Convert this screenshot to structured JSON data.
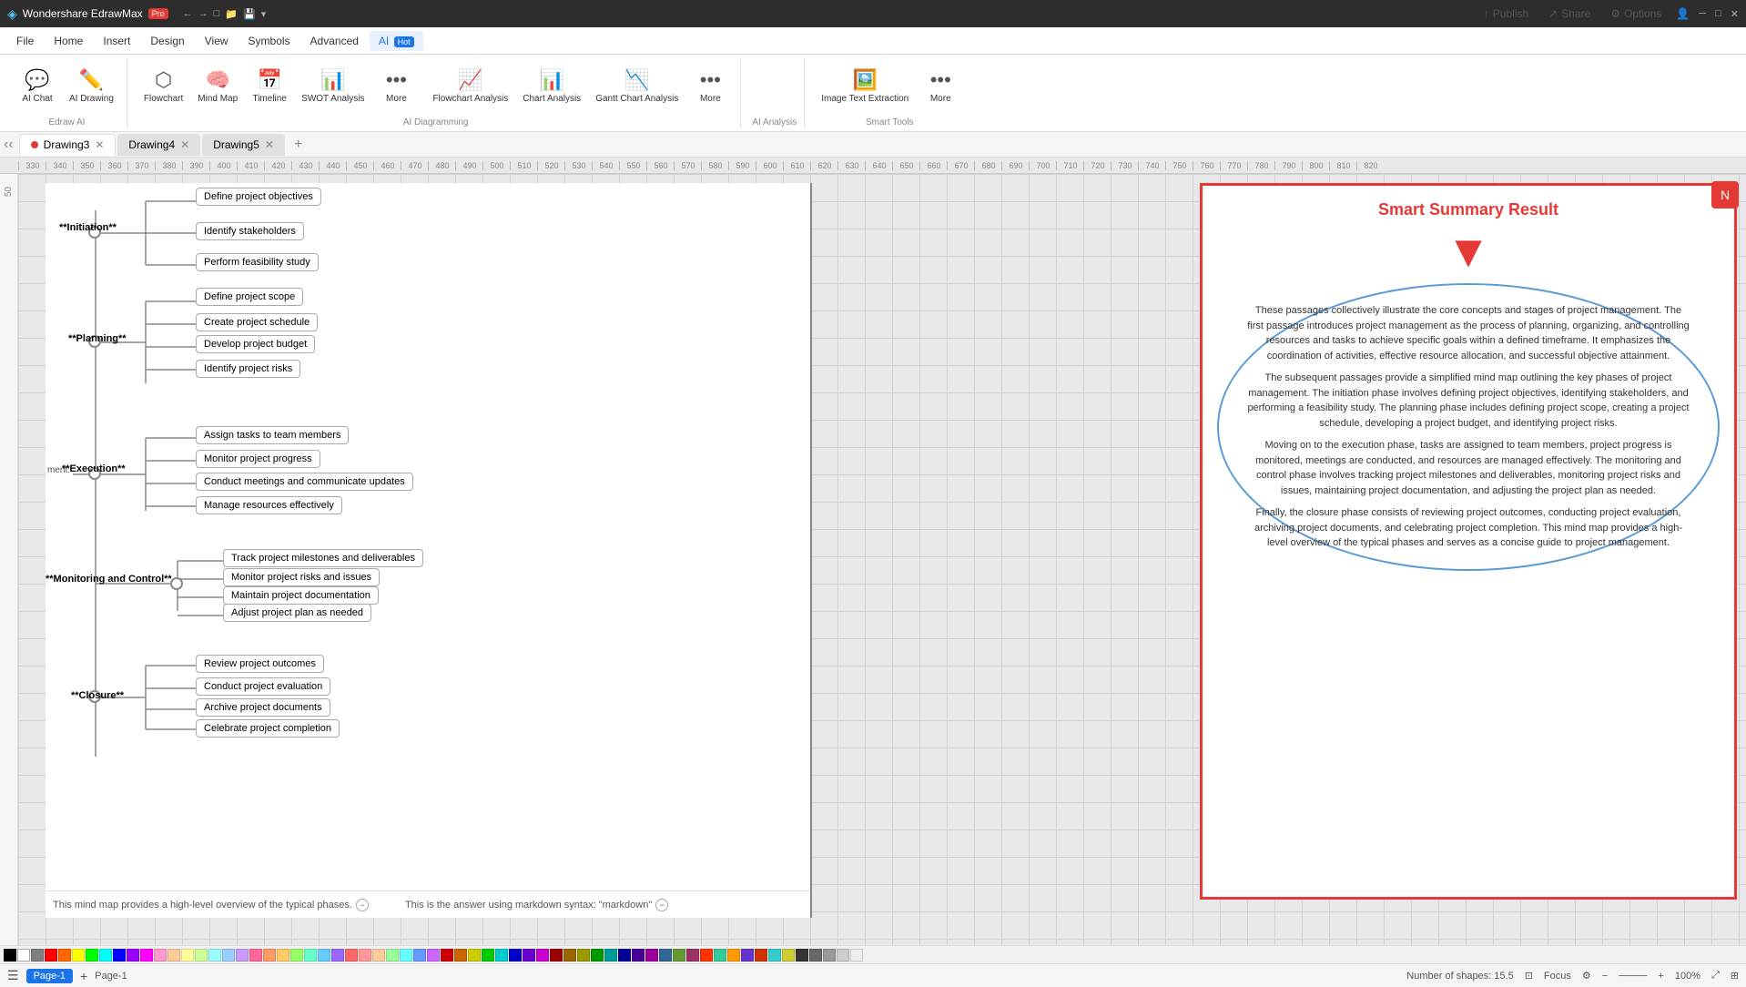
{
  "app": {
    "title": "Wondershare EdrawMax - Pro",
    "window_controls": [
      "minimize",
      "maximize",
      "close"
    ]
  },
  "title_bar": {
    "app_name": "Wondershare EdrawMax",
    "badge": "Pro",
    "toolbar_icons": [
      "back",
      "forward",
      "new",
      "open",
      "save",
      "more"
    ]
  },
  "menu_bar": {
    "items": [
      "File",
      "Home",
      "Insert",
      "Design",
      "View",
      "Symbols",
      "Advanced",
      "AI"
    ]
  },
  "toolbar": {
    "groups": [
      {
        "label": "Edraw AI",
        "items": [
          {
            "icon": "💬",
            "label": "AI Chat"
          },
          {
            "icon": "✏️",
            "label": "AI Drawing"
          }
        ]
      },
      {
        "label": "AI Diagramming",
        "items": [
          {
            "icon": "⬡",
            "label": "Flowchart"
          },
          {
            "icon": "🧠",
            "label": "Mind Map"
          },
          {
            "icon": "📅",
            "label": "Timeline"
          },
          {
            "icon": "📊",
            "label": "SWOT Analysis"
          },
          {
            "icon": "•••",
            "label": "More"
          },
          {
            "icon": "📈",
            "label": "Flowchart Analysis"
          },
          {
            "icon": "📊",
            "label": "Chart Analysis"
          },
          {
            "icon": "📉",
            "label": "Gantt Chart Analysis"
          },
          {
            "icon": "•••",
            "label": "More"
          }
        ]
      },
      {
        "label": "Smart Tools",
        "items": [
          {
            "icon": "🖼️",
            "label": "Image Text Extraction"
          },
          {
            "icon": "•••",
            "label": "More"
          }
        ]
      }
    ]
  },
  "tabs": [
    {
      "name": "Drawing3",
      "active": true,
      "has_dot": true
    },
    {
      "name": "Drawing4",
      "active": false,
      "has_dot": false
    },
    {
      "name": "Drawing5",
      "active": false,
      "has_dot": false
    }
  ],
  "ruler": {
    "marks": [
      "330",
      "340",
      "350",
      "360",
      "370",
      "380",
      "390",
      "400",
      "410",
      "420",
      "430",
      "440",
      "450",
      "460",
      "470",
      "480",
      "490",
      "500",
      "510",
      "520",
      "530",
      "540",
      "550",
      "560",
      "570",
      "580",
      "590",
      "600",
      "610",
      "620",
      "630",
      "640",
      "650",
      "660",
      "670",
      "680",
      "690",
      "700",
      "710",
      "720",
      "730",
      "740",
      "750",
      "760",
      "770",
      "780",
      "790",
      "800",
      "810",
      "820"
    ]
  },
  "mind_map": {
    "center": "ment:",
    "phases": [
      {
        "name": "**Initiation**",
        "tasks": [
          "Define project objectives",
          "Identify stakeholders",
          "Perform feasibility study"
        ]
      },
      {
        "name": "**Planning**",
        "tasks": [
          "Define project scope",
          "Create project schedule",
          "Develop project budget",
          "Identify project risks"
        ]
      },
      {
        "name": "**Execution**",
        "tasks": [
          "Assign tasks to team members",
          "Monitor project progress",
          "Conduct meetings and communicate updates",
          "Manage resources effectively"
        ]
      },
      {
        "name": "**Monitoring and Control**",
        "tasks": [
          "Track project milestones and deliverables",
          "Monitor project risks and issues",
          "Maintain project documentation",
          "Adjust project plan as needed"
        ]
      },
      {
        "name": "**Closure**",
        "tasks": [
          "Review project outcomes",
          "Conduct project evaluation",
          "Archive project documents",
          "Celebrate project completion"
        ]
      }
    ]
  },
  "smart_summary": {
    "title": "Smart Summary Result",
    "arrow": "▼",
    "content": "These passages collectively illustrate the core concepts and stages of project management. The first passage introduces project management as the process of planning, organizing, and controlling resources and tasks to achieve specific goals within a defined timeframe. It emphasizes the coordination of activities, effective resource allocation, and successful objective attainment.\n\nThe subsequent passages provide a simplified mind map outlining the key phases of project management. The initiation phase involves defining project objectives, identifying stakeholders, and performing a feasibility study. The planning phase includes defining project scope, creating a project schedule, developing a project budget, and identifying project risks.\n\nMoving on to the execution phase, tasks are assigned to team members, project progress is monitored, meetings are conducted, and resources are managed effectively. The monitoring and control phase involves tracking project milestones and deliverables, monitoring project risks and issues, maintaining project documentation, and adjusting the project plan as needed.\n\nFinally, the closure phase consists of reviewing project outcomes, conducting project evaluation, archiving project documents, and celebrating project completion. This mind map provides a high-level overview of the typical phases and serves as a concise guide to project management."
  },
  "bottom_text": {
    "left": "This mind map provides a high-level overview of the typical phases.",
    "right": "This is the answer using markdown syntax: \"markdown\""
  },
  "status_bar": {
    "page": "Page-1",
    "shapes_count": "Number of shapes: 15.5",
    "zoom": "100%",
    "page_label": "Page-1"
  },
  "color_palette": [
    "#000000",
    "#ffffff",
    "#7f7f7f",
    "#ff0000",
    "#ff6600",
    "#ffff00",
    "#00ff00",
    "#00ffff",
    "#0000ff",
    "#9900ff",
    "#ff00ff",
    "#ff99cc",
    "#ffcc99",
    "#ffff99",
    "#ccff99",
    "#99ffff",
    "#99ccff",
    "#cc99ff",
    "#ff6699",
    "#ff9966",
    "#ffcc66",
    "#99ff66",
    "#66ffcc",
    "#66ccff",
    "#9966ff",
    "#ff6666",
    "#ff9999",
    "#ffcc99",
    "#99ff99",
    "#66ffff",
    "#6699ff",
    "#cc66ff",
    "#cc0000",
    "#cc6600",
    "#cccc00",
    "#00cc00",
    "#00cccc",
    "#0000cc",
    "#6600cc",
    "#cc00cc",
    "#990000",
    "#996600",
    "#999900",
    "#009900",
    "#009999",
    "#000099",
    "#490099",
    "#990099"
  ]
}
